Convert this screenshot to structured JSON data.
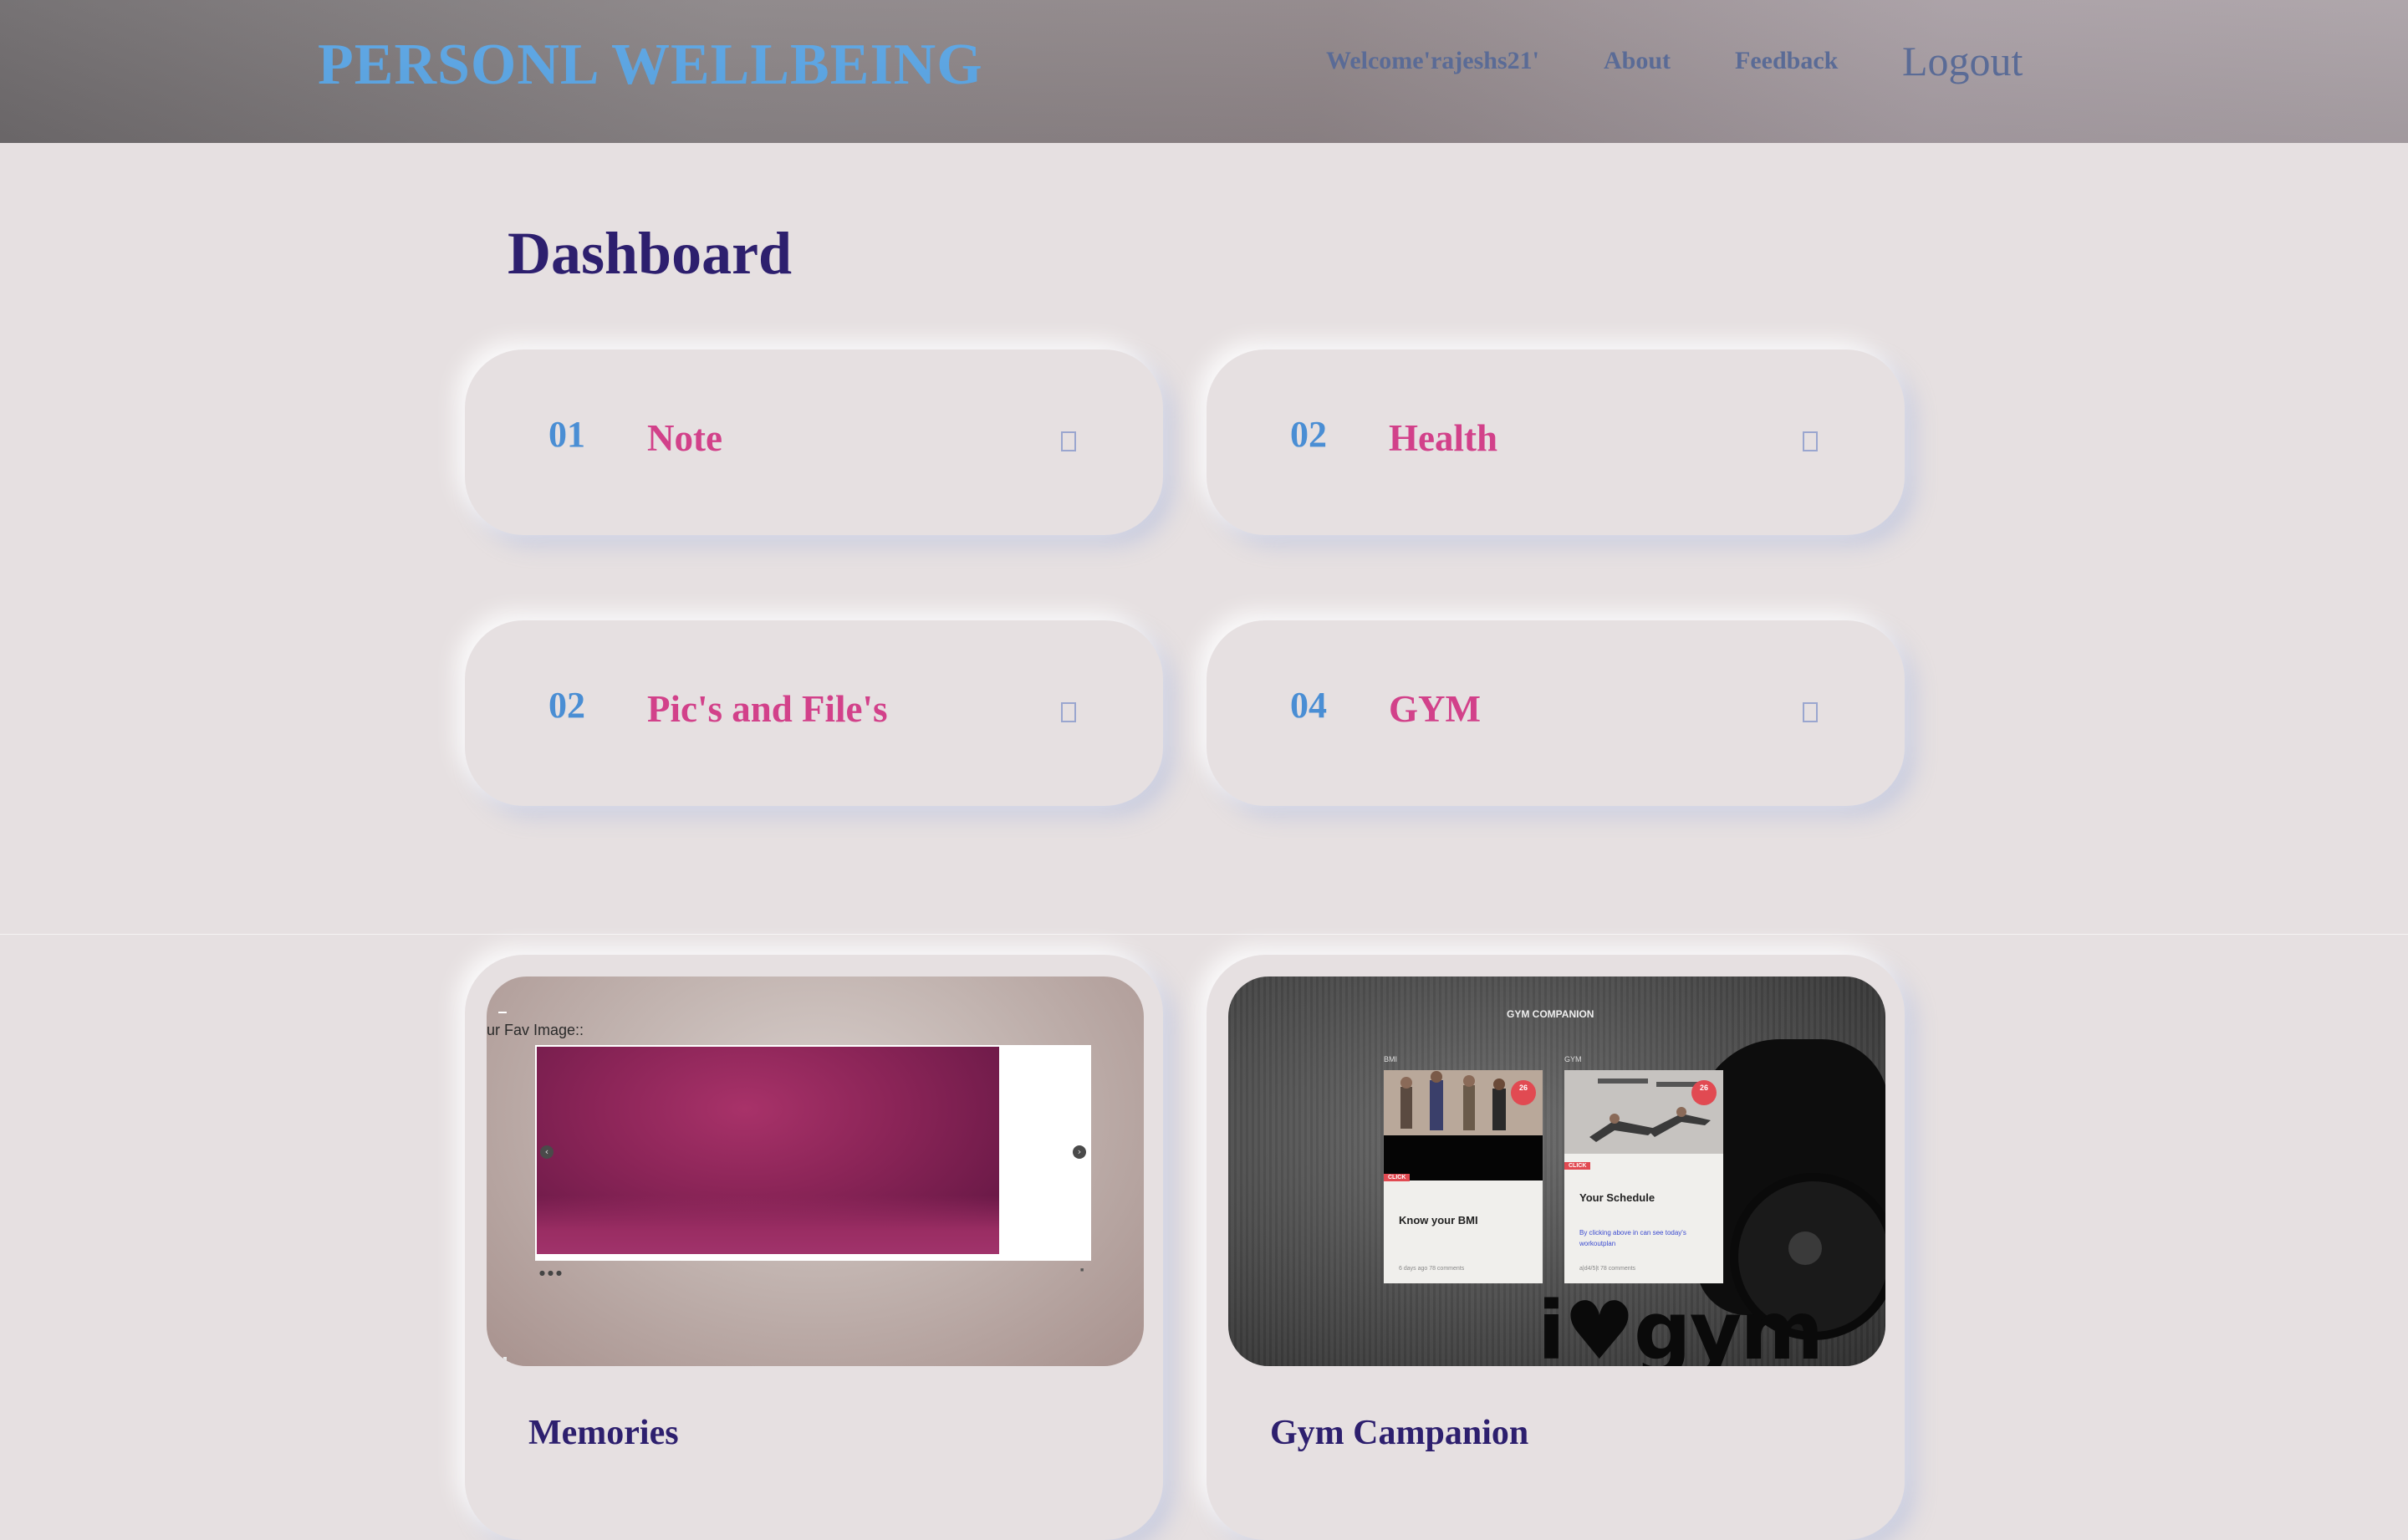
{
  "header": {
    "brand": "PERSONL WELLBEING",
    "nav": {
      "welcome": "Welcome'rajeshs21'",
      "about": "About",
      "feedback": "Feedback",
      "logout": "Logout"
    }
  },
  "dashboard": {
    "title": "Dashboard",
    "tiles": [
      {
        "number": "01",
        "label": "Note",
        "icon": "arrow-icon"
      },
      {
        "number": "02",
        "label": "Health",
        "icon": "arrow-icon"
      },
      {
        "number": "02",
        "label": "Pic's and File's",
        "icon": "arrow-icon"
      },
      {
        "number": "04",
        "label": "GYM",
        "icon": "arrow-icon"
      }
    ]
  },
  "cards": [
    {
      "title": "Memories",
      "preview": {
        "caption": "ur Fav Image::"
      }
    },
    {
      "title": "Gym Campanion",
      "preview": {
        "heading": "GYM COMPANION",
        "logo": "i♥gym",
        "tiles": [
          {
            "category": "BMI",
            "badge": "26",
            "click": "CLICK",
            "title": "Know your BMI",
            "meta": "6 days ago   78 comments"
          },
          {
            "category": "GYM",
            "badge": "26",
            "click": "CLICK",
            "title": "Your Schedule",
            "desc": "By clicking above in can see today's workoutplan",
            "meta": "a|d4/5|t   78 comments"
          }
        ]
      }
    }
  ],
  "colors": {
    "brand": "#5aa6e6",
    "nav": "#5a6b96",
    "title": "#2d1f6e",
    "tile_number": "#4a8ed4",
    "tile_label": "#d2418a",
    "background": "#e6e0e1"
  }
}
